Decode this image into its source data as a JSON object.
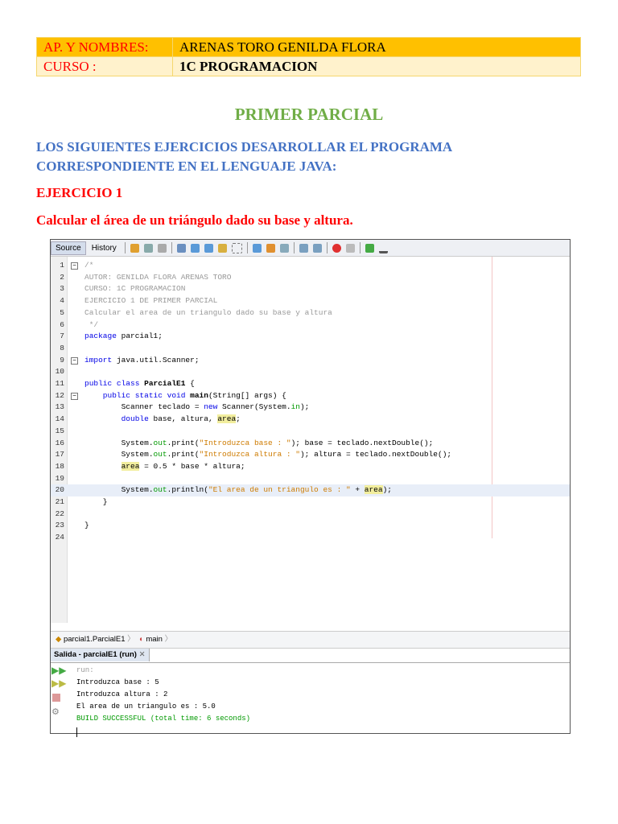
{
  "header": {
    "rows": [
      {
        "label": "AP. Y NOMBRES:",
        "value": "ARENAS TORO GENILDA FLORA"
      },
      {
        "label": "CURSO :",
        "value": "1C PROGRAMACION"
      }
    ]
  },
  "title": "PRIMER PARCIAL",
  "intro": [
    "LOS SIGUIENTES EJERCICIOS DESARROLLAR EL PROGRAMA",
    "CORRESPONDIENTE EN EL LENGUAJE JAVA:"
  ],
  "exercise": "EJERCICIO 1",
  "task": "Calcular el área de un triángulo dado su base y altura.",
  "ide": {
    "tabs": [
      "Source",
      "History"
    ],
    "code": [
      [
        [
          "/*",
          "cm"
        ]
      ],
      [
        [
          "AUTOR: GENILDA FLORA ARENAS TORO",
          "cm"
        ]
      ],
      [
        [
          "CURSO: 1C PROGRAMACION",
          "cm"
        ]
      ],
      [
        [
          "EJERCICIO 1 DE PRIMER PARCIAL",
          "cm"
        ]
      ],
      [
        [
          "Calcular el area de un triangulo dado su base y altura",
          "cm"
        ]
      ],
      [
        [
          " */",
          "cm"
        ]
      ],
      [
        [
          "package",
          "kw"
        ],
        [
          " parcial1;",
          ""
        ]
      ],
      [],
      [
        [
          "import",
          "kw"
        ],
        [
          " java.util.Scanner;",
          ""
        ]
      ],
      [],
      [
        [
          "public class ",
          "kw"
        ],
        [
          "ParcialE1",
          "b"
        ],
        [
          " {",
          ""
        ]
      ],
      [
        [
          "    public static void ",
          "kw"
        ],
        [
          "main",
          "b"
        ],
        [
          "(String[] args) {",
          ""
        ]
      ],
      [
        [
          "        Scanner teclado = ",
          ""
        ],
        [
          "new",
          "kw"
        ],
        [
          " Scanner(System.",
          ""
        ],
        [
          "in",
          "fd"
        ],
        [
          ");",
          ""
        ]
      ],
      [
        [
          "        double",
          "kw"
        ],
        [
          " base, altura, ",
          ""
        ],
        [
          "area",
          "hl"
        ],
        [
          ";",
          ""
        ]
      ],
      [],
      [
        [
          "        System.",
          ""
        ],
        [
          "out",
          "fd"
        ],
        [
          ".print(",
          ""
        ],
        [
          "\"Introduzca base : \"",
          "st"
        ],
        [
          "); base = teclado.nextDouble();",
          ""
        ]
      ],
      [
        [
          "        System.",
          ""
        ],
        [
          "out",
          "fd"
        ],
        [
          ".print(",
          ""
        ],
        [
          "\"Introduzca altura : \"",
          "st"
        ],
        [
          "); altura = teclado.nextDouble();",
          ""
        ]
      ],
      [
        [
          "        ",
          ""
        ],
        [
          "area",
          "hl"
        ],
        [
          " = 0.5 * base * altura;",
          ""
        ]
      ],
      [],
      [
        [
          "        System.",
          ""
        ],
        [
          "out",
          "fd"
        ],
        [
          ".println(",
          ""
        ],
        [
          "\"El area de un triangulo es : \"",
          "st"
        ],
        [
          " + ",
          ""
        ],
        [
          "area",
          "hl"
        ],
        [
          ");",
          ""
        ]
      ],
      [
        [
          "    }",
          ""
        ]
      ],
      [],
      [
        [
          "}",
          ""
        ]
      ],
      []
    ],
    "breadcrumb": [
      "parcial1.ParcialE1",
      "main"
    ],
    "output_tab": "Salida - parcialE1 (run)",
    "output": [
      {
        "text": "run:",
        "type": "cm"
      },
      {
        "text": "Introduzca base : 5",
        "type": ""
      },
      {
        "text": "Introduzca altura : 2",
        "type": ""
      },
      {
        "text": "El area de un triangulo es : 5.0",
        "type": ""
      },
      {
        "text": "BUILD SUCCESSFUL (total time: 6 seconds)",
        "type": "fd"
      }
    ]
  }
}
